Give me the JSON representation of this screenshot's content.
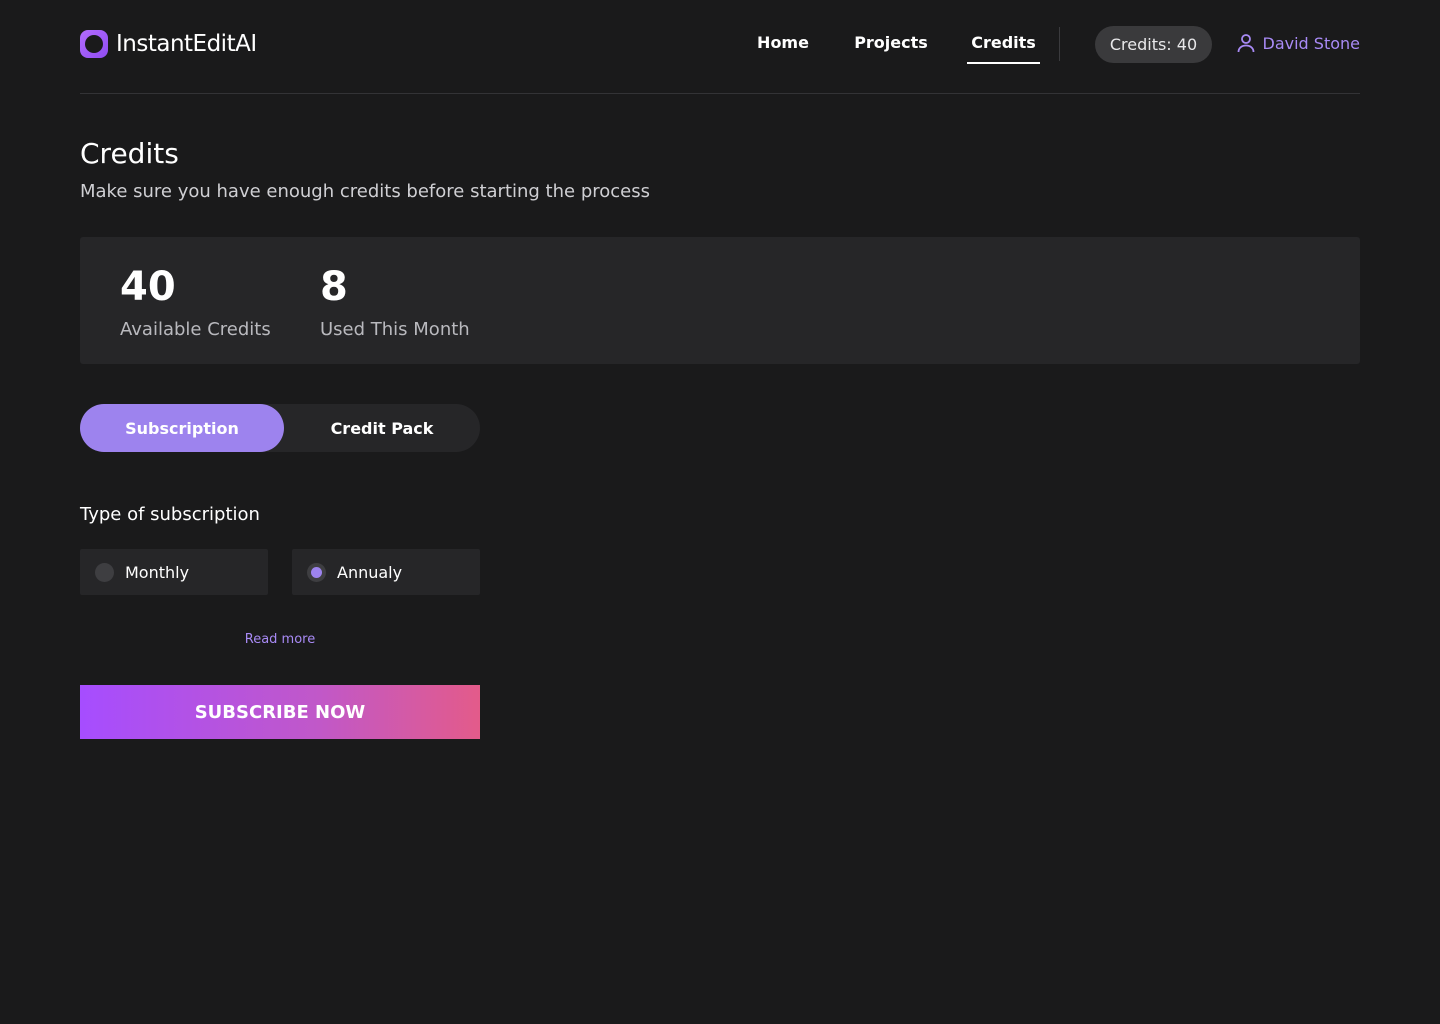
{
  "header": {
    "brand": "InstantEditAI",
    "nav": {
      "home": "Home",
      "projects": "Projects",
      "credits": "Credits"
    },
    "credits_badge": "Credits: 40",
    "user_name": "David Stone"
  },
  "page": {
    "title": "Credits",
    "subtitle": "Make sure you have enough credits before starting the process"
  },
  "stats": {
    "available": {
      "value": "40",
      "label": "Available Credits"
    },
    "used": {
      "value": "8",
      "label": "Used This Month"
    }
  },
  "tabs": {
    "subscription": "Subscription",
    "credit_pack": "Credit Pack",
    "selected": "Subscription"
  },
  "subscription_type": {
    "label": "Type of subscription",
    "options": {
      "monthly": "Monthly",
      "annually": "Annualy"
    },
    "selected": "Annualy"
  },
  "read_more": "Read more",
  "cta": "SUBSCRIBE NOW",
  "colors": {
    "background": "#1a1a1b",
    "card": "#262628",
    "accent": "#9d83ee",
    "link": "#a88af5",
    "cta_gradient_start": "#a64dff",
    "cta_gradient_end": "#e35b8a"
  }
}
